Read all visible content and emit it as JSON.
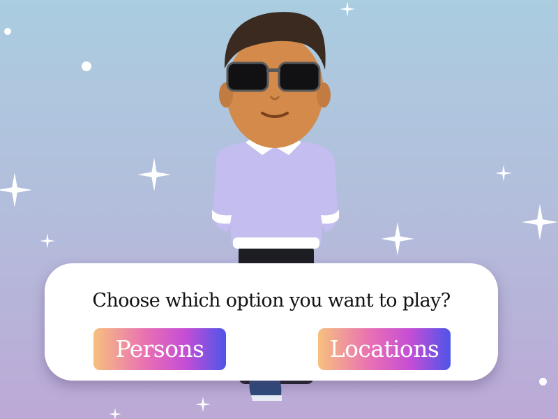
{
  "game": {
    "question": "Choose which option you want to play?",
    "options": [
      {
        "label": "Persons"
      },
      {
        "label": "Locations"
      }
    ]
  },
  "avatar": {
    "name": "avatar-character",
    "shirt_color": "#c3bdf0",
    "hair_color": "#3a2a20",
    "skin_color": "#d38a4a"
  },
  "colors": {
    "background_top": "#aacde0",
    "background_bottom": "#bca9d6",
    "button_gradient": [
      "#f7c07e",
      "#e86fb4",
      "#c44dd6",
      "#4e55e8"
    ],
    "dialog": "#ffffff"
  }
}
